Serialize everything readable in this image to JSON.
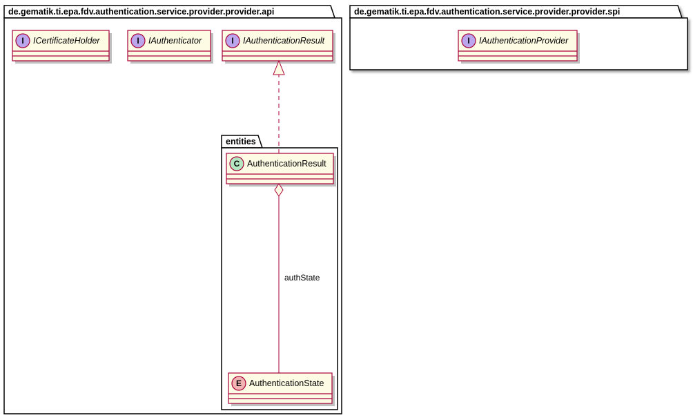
{
  "packages": {
    "api": {
      "name": "de.gematik.ti.epa.fdv.authentication.service.provider.provider.api"
    },
    "spi": {
      "name": "de.gematik.ti.epa.fdv.authentication.service.provider.provider.spi"
    },
    "entities": {
      "name": "entities"
    }
  },
  "classes": {
    "ICertificateHolder": {
      "name": "ICertificateHolder",
      "stereo": "I"
    },
    "IAuthenticator": {
      "name": "IAuthenticator",
      "stereo": "I"
    },
    "IAuthenticationResult": {
      "name": "IAuthenticationResult",
      "stereo": "I"
    },
    "IAuthenticationProvider": {
      "name": "IAuthenticationProvider",
      "stereo": "I"
    },
    "AuthenticationResult": {
      "name": "AuthenticationResult",
      "stereo": "C"
    },
    "AuthenticationState": {
      "name": "AuthenticationState",
      "stereo": "E"
    }
  },
  "relations": {
    "aggregationLabel": "authState"
  }
}
